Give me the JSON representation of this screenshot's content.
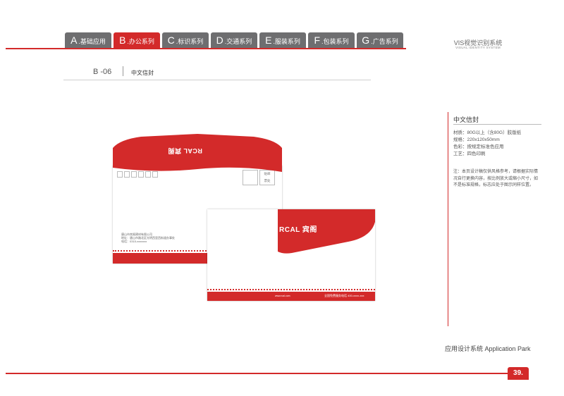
{
  "tabs": [
    {
      "letter": "A",
      "label": ".基础应用"
    },
    {
      "letter": "B",
      "label": ".办公系列"
    },
    {
      "letter": "C",
      "label": ".标识系列"
    },
    {
      "letter": "D",
      "label": ".交通系列"
    },
    {
      "letter": "E",
      "label": ".服装系列"
    },
    {
      "letter": "F",
      "label": ".包装系列"
    },
    {
      "letter": "G",
      "label": ".广告系列"
    }
  ],
  "header": {
    "vis_title": "VIS视觉识别系统",
    "vis_subtitle": "VISUAL IDENTITY SYSTEM"
  },
  "section": {
    "code": "B -06",
    "name": "中文信封"
  },
  "panel": {
    "title": "中文信封",
    "specs": [
      "材质：80G以上（含80G）胶版纸",
      "规格：220x120x50mm",
      "色彩：按规定标准色应用",
      "工艺：四色印刷"
    ],
    "note": "注：本页设计稿仅供风格参考，请根据实际情况自行更换内容，按比例放大或缩小尺寸，如不是标准规格，标志应处于图示同样位置。"
  },
  "envelope": {
    "logo_en": "RCAL",
    "logo_cn": "宾阁",
    "stamp_text": [
      "贴",
      "邮",
      "票",
      "处"
    ],
    "address": [
      "唐山市宾阁建材有限公司",
      "地址：唐山市路北区光明西里西街道办事处",
      "电话：0315-xxxxxxx"
    ],
    "url": "www.rcal.com",
    "hotline": "全国免费服务电话   400-xxxx-xxx"
  },
  "footer": {
    "app_text": "应用设计系统  Application Park",
    "page_number": "39."
  },
  "colors": {
    "brand_red": "#d32a2a",
    "tab_gray": "#6e6e70"
  }
}
